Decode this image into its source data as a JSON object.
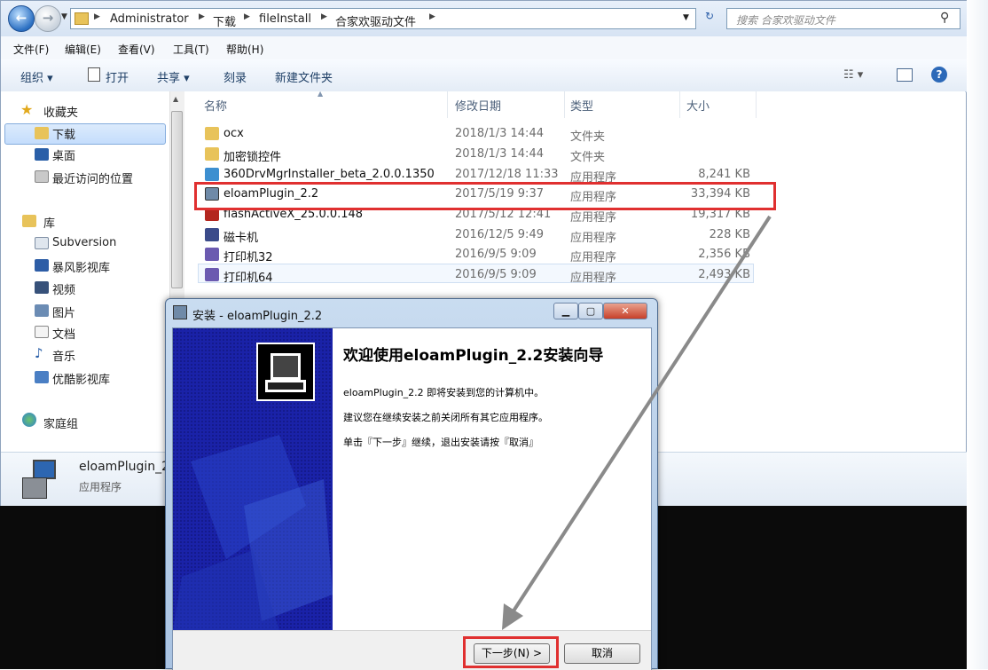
{
  "explorer": {
    "breadcrumb": [
      "Administrator",
      "下载",
      "fileInstall",
      "合家欢驱动文件"
    ],
    "search_placeholder": "搜索 合家欢驱动文件",
    "menu": [
      "文件(F)",
      "编辑(E)",
      "查看(V)",
      "工具(T)",
      "帮助(H)"
    ],
    "toolbar": {
      "organize": "组织 ▾",
      "open": "打开",
      "share": "共享 ▾",
      "burn": "刻录",
      "new_folder": "新建文件夹"
    },
    "nav": {
      "favorites": "收藏夹",
      "downloads": "下载",
      "desktop": "桌面",
      "recent": "最近访问的位置",
      "libraries": "库",
      "subversion": "Subversion",
      "baofeng": "暴风影视库",
      "videos": "视频",
      "pictures": "图片",
      "documents": "文档",
      "music": "音乐",
      "youku": "优酷影视库",
      "homegroup": "家庭组"
    },
    "columns": {
      "name": "名称",
      "date": "修改日期",
      "type": "类型",
      "size": "大小"
    },
    "files": [
      {
        "name": "ocx",
        "date": "2018/1/3 14:44",
        "type": "文件夹",
        "size": ""
      },
      {
        "name": "加密锁控件",
        "date": "2018/1/3 14:44",
        "type": "文件夹",
        "size": ""
      },
      {
        "name": "360DrvMgrInstaller_beta_2.0.0.1350",
        "date": "2017/12/18 11:33",
        "type": "应用程序",
        "size": "8,241 KB"
      },
      {
        "name": "eloamPlugin_2.2",
        "date": "2017/5/19 9:37",
        "type": "应用程序",
        "size": "33,394 KB"
      },
      {
        "name": "flashActiveX_25.0.0.148",
        "date": "2017/5/12 12:41",
        "type": "应用程序",
        "size": "19,317 KB"
      },
      {
        "name": "磁卡机",
        "date": "2016/12/5 9:49",
        "type": "应用程序",
        "size": "228 KB"
      },
      {
        "name": "打印机32",
        "date": "2016/9/5 9:09",
        "type": "应用程序",
        "size": "2,356 KB"
      },
      {
        "name": "打印机64",
        "date": "2016/9/5 9:09",
        "type": "应用程序",
        "size": "2,493 KB"
      }
    ],
    "status": {
      "name": "eloamPlugin_2",
      "type": "应用程序"
    }
  },
  "dialog": {
    "title": "安装 - eloamPlugin_2.2",
    "heading": "欢迎使用eloamPlugin_2.2安装向导",
    "line1": "eloamPlugin_2.2 即将安装到您的计算机中。",
    "line2": "建议您在继续安装之前关闭所有其它应用程序。",
    "line3": "单击『下一步』继续，退出安装请按『取消』",
    "next_label": "下一步(N) >",
    "cancel_label": "取消"
  },
  "colors": {
    "highlight_red": "#e03030",
    "banner_blue": "#1a22a8"
  }
}
